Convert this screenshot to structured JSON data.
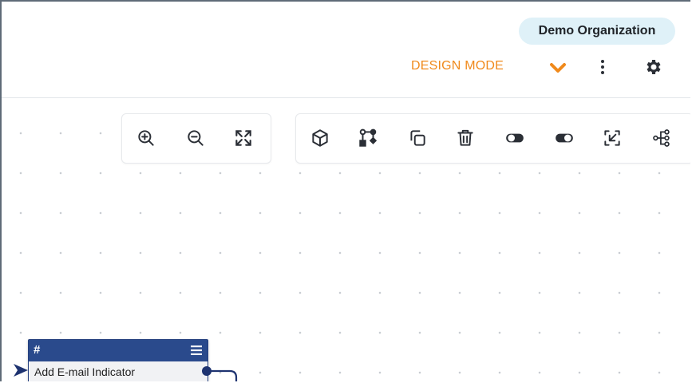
{
  "header": {
    "organization": "Demo Organization",
    "mode_label": "DESIGN MODE",
    "icons": [
      "chevron-down-icon",
      "more-vertical-icon",
      "gear-icon"
    ]
  },
  "toolbar_zoom": {
    "buttons": [
      {
        "name": "zoom-in-icon"
      },
      {
        "name": "zoom-out-icon"
      },
      {
        "name": "fit-screen-icon"
      }
    ]
  },
  "toolbar_actions": {
    "buttons": [
      {
        "name": "cube-icon"
      },
      {
        "name": "connect-nodes-icon"
      },
      {
        "name": "copy-icon"
      },
      {
        "name": "trash-icon"
      },
      {
        "name": "toggle-off-icon"
      },
      {
        "name": "toggle-on-icon"
      },
      {
        "name": "select-area-icon"
      },
      {
        "name": "tree-layout-icon"
      }
    ]
  },
  "node": {
    "type_symbol": "#",
    "label": "Add E-mail Indicator"
  },
  "colors": {
    "accent_orange": "#f08a1c",
    "badge_bg": "#dff1f8",
    "node_header": "#2a4a8c",
    "icon_dark": "#2b2f36"
  }
}
